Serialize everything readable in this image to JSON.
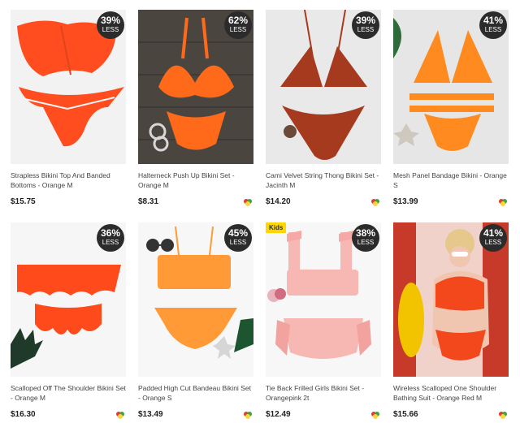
{
  "products": [
    {
      "title": "Strapless Bikini Top And Banded Bottoms - Orange M",
      "price": "$15.75",
      "discount": "39%",
      "badge_suffix": "LESS",
      "color": "#ff4d1f",
      "bg": "#f2f2f2"
    },
    {
      "title": "Halterneck Push Up Bikini Set - Orange M",
      "price": "$8.31",
      "discount": "62%",
      "badge_suffix": "LESS",
      "color": "#ff6a1a",
      "bg": "#4b4540"
    },
    {
      "title": "Cami Velvet String Thong Bikini Set - Jacinth M",
      "price": "$14.20",
      "discount": "39%",
      "badge_suffix": "LESS",
      "color": "#a63a1f",
      "bg": "#e9e9e9"
    },
    {
      "title": "Mesh Panel Bandage Bikini - Orange S",
      "price": "$13.99",
      "discount": "41%",
      "badge_suffix": "LESS",
      "color": "#ff8a1f",
      "bg": "#e6e6e6"
    },
    {
      "title": "Scalloped Off The Shoulder Bikini Set - Orange M",
      "price": "$16.30",
      "discount": "36%",
      "badge_suffix": "LESS",
      "color": "#ff4a1c",
      "bg": "#f6f6f6"
    },
    {
      "title": "Padded High Cut Bandeau Bikini Set - Orange S",
      "price": "$13.49",
      "discount": "45%",
      "badge_suffix": "LESS",
      "color": "#ff9a36",
      "bg": "#f7f7f7"
    },
    {
      "title": "Tie Back Frilled Girls Bikini Set - Orangepink 2t",
      "price": "$12.49",
      "discount": "38%",
      "badge_suffix": "LESS",
      "color": "#f7b7b3",
      "bg": "#f7f7f7",
      "tag": "Kids"
    },
    {
      "title": "Wireless Scalloped One Shoulder Bathing Suit - Orange Red M",
      "price": "$15.66",
      "discount": "41%",
      "badge_suffix": "LESS",
      "color": "#f2481c",
      "bg": "#f2d6cf"
    }
  ]
}
